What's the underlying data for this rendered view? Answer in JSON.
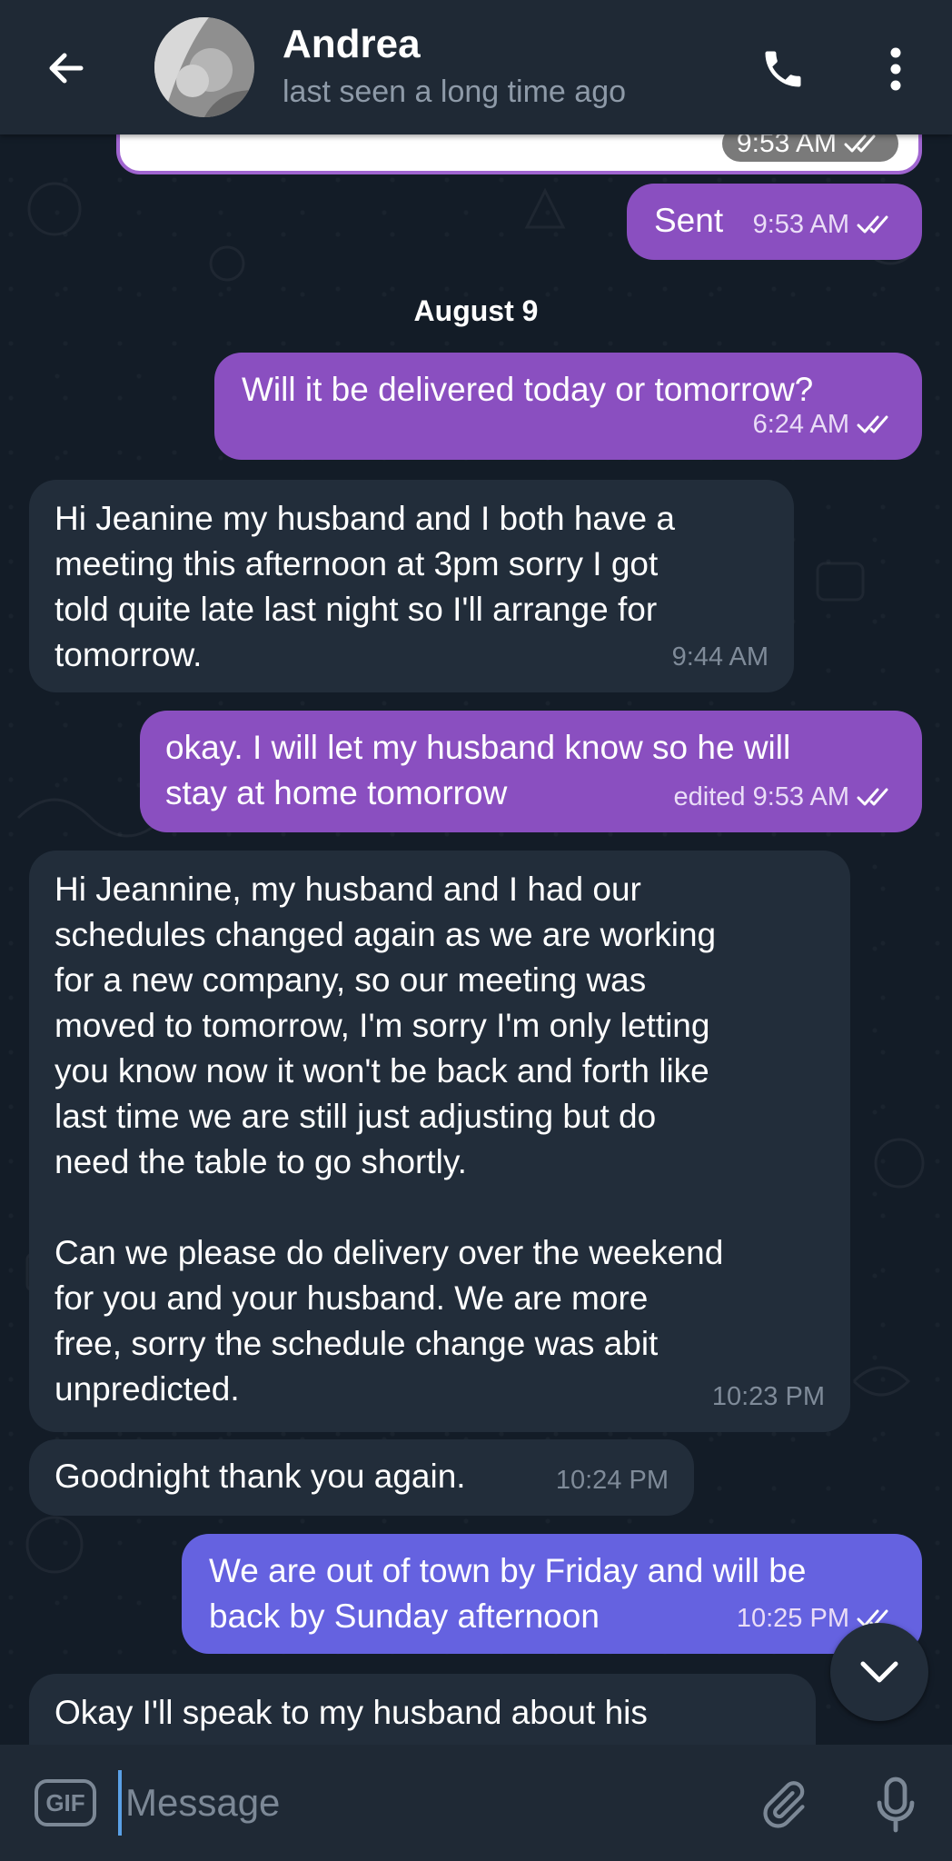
{
  "header": {
    "contact_name": "Andrea",
    "status": "last seen a long time ago"
  },
  "partial_message": {
    "time": "9:53 AM"
  },
  "date_separator": "August 9",
  "messages": [
    {
      "direction": "out",
      "text": "Sent",
      "time": "9:53 AM",
      "read": true
    },
    {
      "direction": "out",
      "text": "Will it be delivered today or tomorrow?",
      "time": "6:24 AM",
      "read": true
    },
    {
      "direction": "in",
      "text": "Hi Jeanine my husband and I both have a\nmeeting this afternoon at 3pm sorry I got\ntold quite late last night so I'll arrange for\ntomorrow.",
      "time": "9:44 AM"
    },
    {
      "direction": "out",
      "text": "okay. I will let my husband know so he will\nstay at home tomorrow",
      "time": "edited 9:53 AM",
      "read": true
    },
    {
      "direction": "in",
      "text": "Hi Jeannine, my husband and I had our\nschedules changed again as we are working\nfor a new company, so our meeting was\nmoved to tomorrow, I'm sorry I'm only letting\nyou know now it won't be back and forth like\nlast time we are still just adjusting but do\nneed the table to go shortly.\n\nCan we please do delivery over the weekend\nfor you and your husband. We are more\nfree, sorry the schedule change was abit\nunpredicted.",
      "time": "10:23 PM"
    },
    {
      "direction": "in",
      "text": "Goodnight thank you again.",
      "time": "10:24 PM"
    },
    {
      "direction": "out",
      "text": "We are out of town by Friday and will be\nback by Sunday afternoon",
      "time": "10:25 PM",
      "read": true
    },
    {
      "direction": "in",
      "text": "Okay I'll speak to my husband about his",
      "time": ""
    }
  ],
  "input": {
    "gif_label": "GIF",
    "placeholder": "Message"
  },
  "icons": {
    "back": "arrow-left",
    "call": "phone",
    "menu": "more-vertical",
    "attach": "paperclip",
    "mic": "microphone",
    "scroll": "chevron-down"
  },
  "colors": {
    "outgoing_bubble": "#8a4fc0",
    "outgoing_bubble_latest": "#6562e0",
    "incoming_bubble": "#222d3a",
    "header_bg": "#1f2935",
    "chat_bg": "#131c27"
  }
}
